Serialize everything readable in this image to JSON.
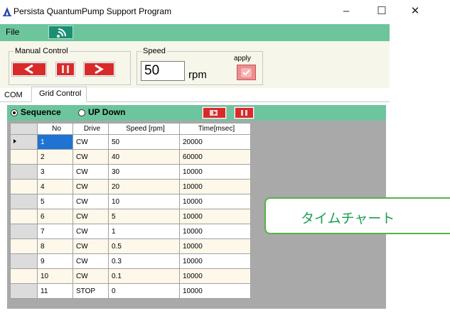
{
  "window": {
    "title": "Persista QuantumPump Support Program",
    "buttons": {
      "minimize": "–",
      "maximize": "☐",
      "close": "✕"
    }
  },
  "menu": {
    "file": "File",
    "wifi_icon": "wifi-icon"
  },
  "manual_control": {
    "label": "Manual  Control",
    "buttons": [
      "left-arrow-icon",
      "pause-icon",
      "right-arrow-icon"
    ]
  },
  "speed": {
    "label": "Speed",
    "value": "50",
    "unit": "rpm",
    "apply_label": "apply"
  },
  "tabs": {
    "com": "COM",
    "grid": "Grid Control",
    "active": "Grid Control"
  },
  "mode": {
    "sequence_label": "Sequence",
    "updown_label": "UP Down",
    "selected": "Sequence"
  },
  "grid": {
    "columns": [
      "No",
      "Drive",
      "Speed [rpm]",
      "Time[msec]"
    ],
    "rows": [
      [
        "1",
        "CW",
        "50",
        "20000"
      ],
      [
        "2",
        "CW",
        "40",
        "60000"
      ],
      [
        "3",
        "CW",
        "30",
        "10000"
      ],
      [
        "4",
        "CW",
        "20",
        "10000"
      ],
      [
        "5",
        "CW",
        "10",
        "10000"
      ],
      [
        "6",
        "CW",
        "5",
        "10000"
      ],
      [
        "7",
        "CW",
        "1",
        "10000"
      ],
      [
        "8",
        "CW",
        "0.5",
        "10000"
      ],
      [
        "9",
        "CW",
        "0.3",
        "10000"
      ],
      [
        "10",
        "CW",
        "0.1",
        "10000"
      ],
      [
        "11",
        "STOP",
        "0",
        "10000"
      ]
    ]
  },
  "callout": "タイムチャート",
  "colors": {
    "accent": "#6cc59d",
    "red": "#d92a2a",
    "selection": "#1f73d3",
    "callout": "#52b44a"
  }
}
